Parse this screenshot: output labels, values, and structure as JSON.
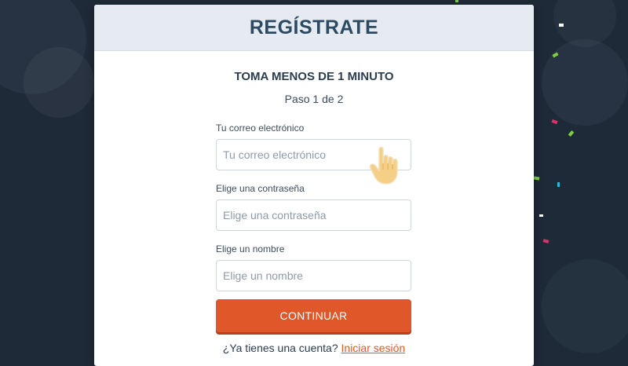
{
  "colors": {
    "background": "#1f2a38",
    "header_bg": "#e6ebf2",
    "title": "#2d4a63",
    "accent": "#e0582a"
  },
  "modal": {
    "title": "REGÍSTRATE",
    "subtitle": "TOMA MENOS DE 1 MINUTO",
    "step": "Paso 1 de 2"
  },
  "form": {
    "email": {
      "label": "Tu correo electrónico",
      "placeholder": "Tu correo electrónico",
      "value": ""
    },
    "password": {
      "label": "Elige una contraseña",
      "placeholder": "Elige una contraseña",
      "value": ""
    },
    "name": {
      "label": "Elige un nombre",
      "placeholder": "Elige un nombre",
      "value": ""
    },
    "submit_label": "CONTINUAR"
  },
  "footer": {
    "prompt": "¿Ya tienes una cuenta?",
    "login_label": "Iniciar sesión"
  },
  "icons": {
    "cursor": "pointing-hand-icon"
  }
}
